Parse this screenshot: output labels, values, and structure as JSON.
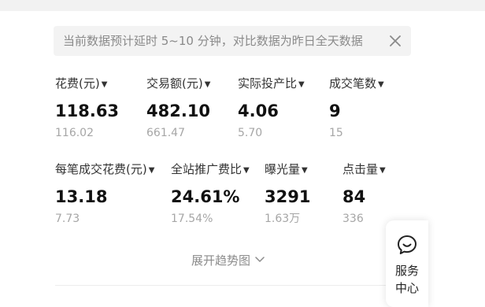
{
  "notice": {
    "text": "当前数据预计延时 5~10 分钟，对比数据为昨日全天数据",
    "close_icon": "close-icon"
  },
  "metrics_row1": [
    {
      "label": "花费(元)",
      "value": "118.63",
      "compare": "116.02"
    },
    {
      "label": "交易额(元)",
      "value": "482.10",
      "compare": "661.47"
    },
    {
      "label": "实际投产比",
      "value": "4.06",
      "compare": "5.70"
    },
    {
      "label": "成交笔数",
      "value": "9",
      "compare": "15"
    }
  ],
  "metrics_row2": [
    {
      "label": "每笔成交花费(元)",
      "value": "13.18",
      "compare": "7.73"
    },
    {
      "label": "全站推广费比",
      "value": "24.61%",
      "compare": "17.54%"
    },
    {
      "label": "曝光量",
      "value": "3291",
      "compare": "1.63万"
    },
    {
      "label": "点击量",
      "value": "84",
      "compare": "336"
    }
  ],
  "expand": {
    "label": "展开趋势图",
    "icon": "chevron-down-icon"
  },
  "service": {
    "label": "服务中心",
    "icon": "chat-bubble-icon"
  }
}
